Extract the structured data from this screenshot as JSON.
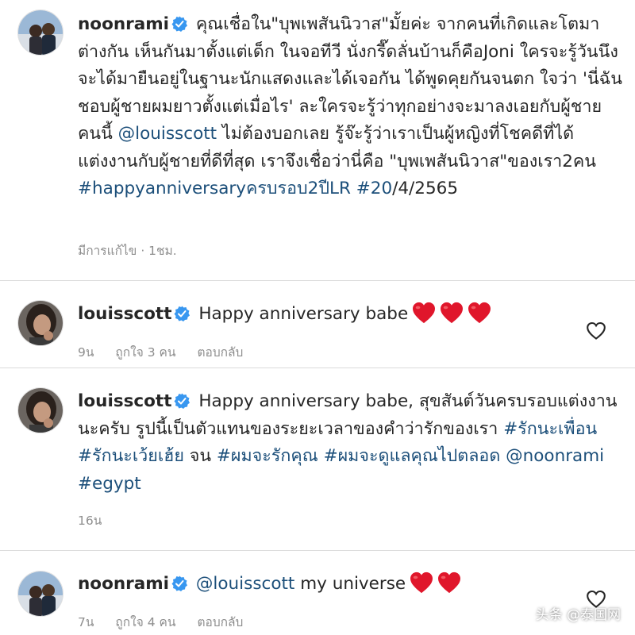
{
  "post": {
    "username": "noonrami",
    "caption": "คุณเชื่อใน\"บุพเพสันนิวาส\"มั้ยค่ะ จากคนที่เกิดและโตมาต่างกัน เห็นกันมาตั้งแต่เด็ก ในจอทีวี นั่งกรี๊ดลั่นบ้านก็คือJoni ใครจะรู้วันนึงจะได้มายืนอยู่ในฐานะนักแสดงและได้เจอกัน ได้พูดคุยกันจนตก ใจว่า 'นี่ฉันชอบผู้ชายผมยาวตั้งแต่เมื่อไร' ละใครจะรู้ว่าทุกอย่างจะมาลงเอยกับผู้ชายคนนี้ ",
    "mention": "@louisscott",
    "caption_2": " ไม่ต้องบอกเลย รู้จ๊ะรู้ว่าเราเป็นผู้หญิงที่โชคดีที่ได้แต่งงานกับผู้ชายที่ดีที่สุด เราจึงเชื่อว่านี่คือ \"บุพเพสันนิวาส\"ของเรา2คน ",
    "hashtag_1": "#happyanniversaryครบรอบ2ปีLR",
    "hashtag_2": "#20",
    "date_suffix": "/4/2565",
    "meta": "มีการแก้ไข · 1ชม."
  },
  "comments": [
    {
      "username": "louisscott",
      "text": "Happy anniversary babe",
      "time": "9น",
      "likes": "ถูกใจ 3 คน",
      "reply": "ตอบกลับ"
    },
    {
      "username": "louisscott",
      "text_1": "Happy anniversary babe, สุขสันต์วันครบรอบแต่งงานนะครับ รูปนี้เป็นตัวแทนของระยะเวลาของคำว่ารักของเรา ",
      "tag_1": "#รักนะเพื่อน",
      "tag_2": "#รักนะเว้ยเฮ้ย",
      "mid": " จน ",
      "tag_3": "#ผมจะรักคุณ",
      "tag_4": "#ผมจะดูแลคุณไปตลอด",
      "mention": "@noonrami",
      "tag_5": "#egypt",
      "time": "16น"
    },
    {
      "username": "noonrami",
      "mention": "@louisscott",
      "text": " my universe",
      "time": "7น",
      "likes": "ถูกใจ 4 คน",
      "reply": "ตอบกลับ"
    }
  ],
  "watermark": "头条 @泰国网",
  "colors": {
    "link": "#1c4f7a",
    "verified": "#3897f0",
    "heart": "#e0162b",
    "meta": "#8e8e8e"
  }
}
